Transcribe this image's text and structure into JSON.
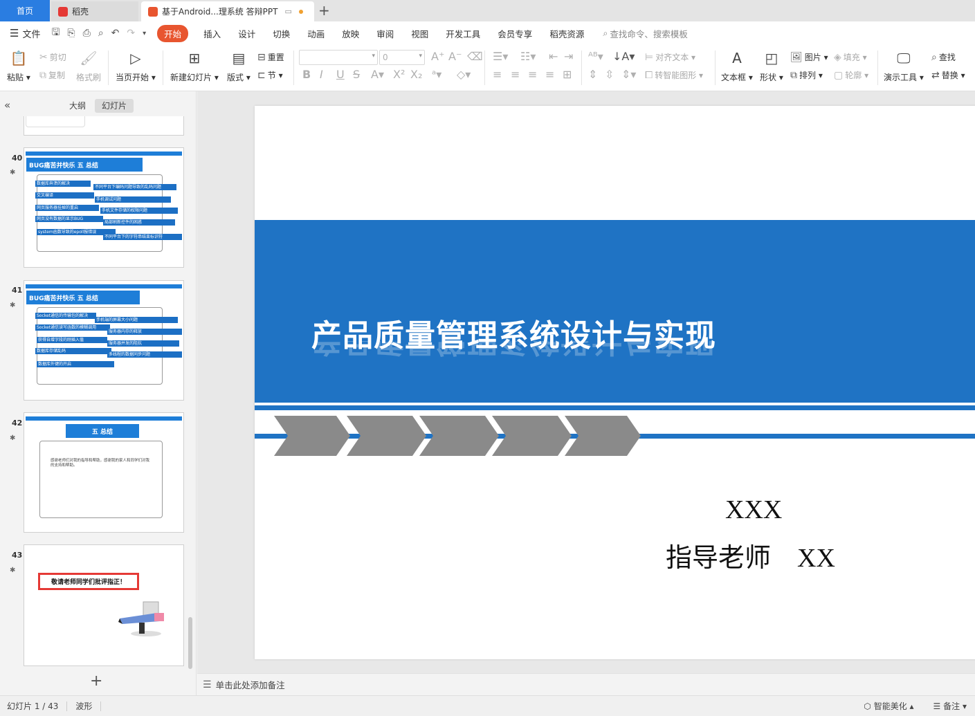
{
  "tabs": {
    "home": "首页",
    "daoke": "稻壳",
    "document": "基于Android...理系统 答辩PPT",
    "new_tab": "+"
  },
  "menu": {
    "file": "文件",
    "items": [
      "开始",
      "插入",
      "设计",
      "切换",
      "动画",
      "放映",
      "审阅",
      "视图",
      "开发工具",
      "会员专享",
      "稻壳资源"
    ],
    "active": "开始",
    "search": "查找命令、搜索模板"
  },
  "ribbon": {
    "paste": "粘贴",
    "cut": "剪切",
    "copy": "复制",
    "format_painter": "格式刷",
    "from_current": "当页开始",
    "new_slide": "新建幻灯片",
    "layout": "版式",
    "reset": "重置",
    "section": "节",
    "font_size": "0",
    "align_text": "对齐文本",
    "smart_shape": "转智能图形",
    "textbox": "文本框",
    "shape": "形状",
    "picture": "图片",
    "arrange": "排列",
    "fill": "填充",
    "outline": "轮廓",
    "presentation_tools": "演示工具",
    "find": "查找",
    "replace": "替换"
  },
  "left_panel": {
    "tab_outline": "大纲",
    "tab_slides": "幻灯片",
    "add": "+"
  },
  "thumbs": [
    {
      "num": "40",
      "title": "BUG痛苦并快乐 五 总结",
      "left_items": [
        "数据库奔溃的解决",
        "交叉编译",
        "网页服务器挂掉的重启",
        "网页没有数据的显示BUG",
        "system函数导致的epoll报错误"
      ],
      "right_items": [
        "不同平台下编码问题导致的乱码问题",
        "手机调试问题",
        "手机文件存储的权限问题",
        "局部刷新控件的困惑",
        "不同平台下的字符串结束标识符"
      ]
    },
    {
      "num": "41",
      "title": "BUG痛苦并快乐 五 总结",
      "left_items": [
        "Socket通信的传输包的解决",
        "Socket通信读写函数的模糊调用",
        "获得自增字段的刚插入值",
        "数据库存储乱码",
        "数据库外键的开启"
      ],
      "right_items": [
        "手机端的屏幕大小问题",
        "服务器内存的释放",
        "服务器并发的阻抗",
        "多线程的数据同步问题"
      ]
    },
    {
      "num": "42",
      "title": "五 总结",
      "text": "感谢老师们对我的指导和帮助，感谢我的家人和同学们对我的支持和帮助。"
    },
    {
      "num": "43",
      "callout": "敬请老师同学们批评指正！"
    }
  ],
  "slide": {
    "title": "产品质量管理系统设计与实现",
    "author": "XXX",
    "advisor": "指导老师    XX"
  },
  "notes": {
    "placeholder": "单击此处添加备注"
  },
  "status": {
    "slide_counter": "幻灯片 1 / 43",
    "theme": "波形",
    "smart_beautify": "智能美化",
    "notes": "备注"
  },
  "colors": {
    "accent": "#2a7de1",
    "start_tab": "#e8552f",
    "slide_blue": "#1f73c4",
    "chevron_gray": "#8a8a8a"
  }
}
